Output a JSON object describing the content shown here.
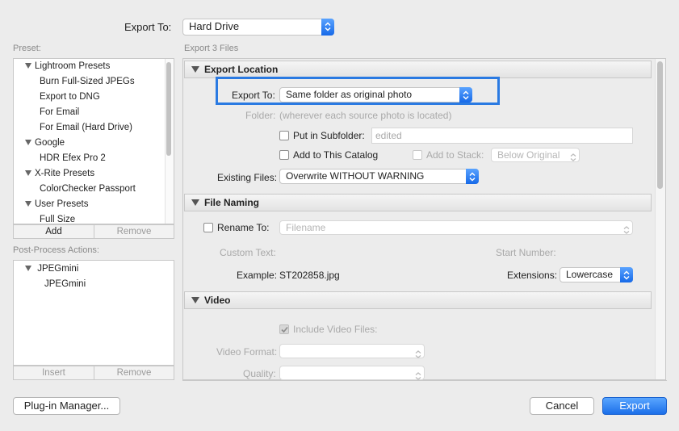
{
  "header": {
    "export_to_label": "Export To:",
    "export_to_value": "Hard Drive",
    "export_files_label": "Export 3 Files"
  },
  "preset": {
    "label": "Preset:",
    "items": [
      {
        "label": "Lightroom Presets",
        "type": "group"
      },
      {
        "label": "Burn Full-Sized JPEGs",
        "type": "item"
      },
      {
        "label": "Export to DNG",
        "type": "item"
      },
      {
        "label": "For Email",
        "type": "item"
      },
      {
        "label": "For Email (Hard Drive)",
        "type": "item"
      },
      {
        "label": "Google",
        "type": "group"
      },
      {
        "label": "HDR Efex Pro 2",
        "type": "item"
      },
      {
        "label": "X-Rite Presets",
        "type": "group"
      },
      {
        "label": "ColorChecker Passport",
        "type": "item"
      },
      {
        "label": "User Presets",
        "type": "group"
      },
      {
        "label": "Full Size",
        "type": "item"
      }
    ],
    "add_label": "Add",
    "remove_label": "Remove"
  },
  "post_process": {
    "label": "Post-Process Actions:",
    "items": [
      {
        "label": "JPEGmini",
        "type": "group"
      },
      {
        "label": "JPEGmini",
        "type": "item"
      }
    ],
    "insert_label": "Insert",
    "remove_label": "Remove"
  },
  "export_location": {
    "title": "Export Location",
    "export_to_label": "Export To:",
    "export_to_value": "Same folder as original photo",
    "folder_label": "Folder:",
    "folder_value": "(wherever each source photo is located)",
    "subfolder_label": "Put in Subfolder:",
    "subfolder_value": "edited",
    "add_catalog_label": "Add to This Catalog",
    "add_stack_label": "Add to Stack:",
    "stack_value": "Below Original",
    "existing_files_label": "Existing Files:",
    "existing_files_value": "Overwrite WITHOUT WARNING"
  },
  "file_naming": {
    "title": "File Naming",
    "rename_label": "Rename To:",
    "rename_value": "Filename",
    "custom_text_label": "Custom Text:",
    "start_number_label": "Start Number:",
    "example_label": "Example:",
    "example_value": "ST202858.jpg",
    "extensions_label": "Extensions:",
    "extensions_value": "Lowercase"
  },
  "video": {
    "title": "Video",
    "include_video_label": "Include Video Files:",
    "video_format_label": "Video Format:",
    "quality_label": "Quality:"
  },
  "footer": {
    "plugin_manager_label": "Plug-in Manager...",
    "cancel_label": "Cancel",
    "export_label": "Export"
  },
  "colors": {
    "accent": "#1b6fe9",
    "highlight_box": "#2a7ae2"
  }
}
